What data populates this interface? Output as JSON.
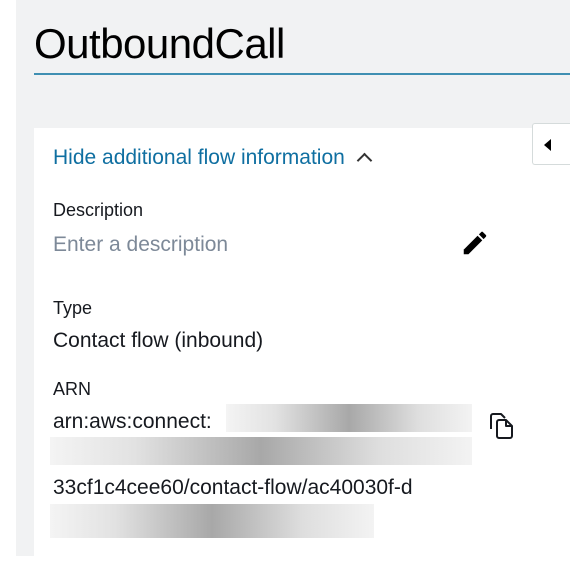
{
  "page": {
    "title": "OutboundCall"
  },
  "flow_info": {
    "toggle_label": "Hide additional flow information",
    "description": {
      "label": "Description",
      "placeholder": "Enter a description"
    },
    "type": {
      "label": "Type",
      "value": "Contact flow (inbound)"
    },
    "arn": {
      "label": "ARN",
      "line1": "arn:aws:connect:",
      "line3": "33cf1c4cee60/contact-flow/ac40030f-d"
    }
  },
  "icons": {
    "collapse": "caret-left-icon",
    "toggle": "chevron-up-icon",
    "edit": "pencil-icon",
    "copy": "copy-icon"
  },
  "colors": {
    "link": "#0f6fa1",
    "title_rule": "#3f8fb2",
    "placeholder": "#7d8998",
    "background": "#f1f2f3"
  }
}
